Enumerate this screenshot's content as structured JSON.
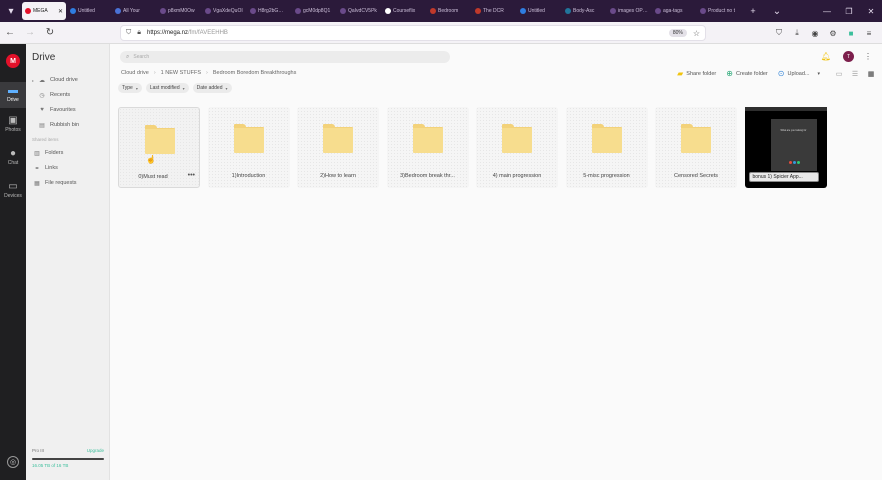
{
  "browser": {
    "tabs": [
      {
        "label": "MEGA",
        "favicon_color": "#e3112a",
        "active": true
      },
      {
        "label": "Untitled",
        "favicon_color": "#2f7de1",
        "active": false
      },
      {
        "label": "All Your",
        "favicon_color": "#4a72d6",
        "active": false
      },
      {
        "label": "p8xmM0Ow",
        "favicon_color": "#6a4a8a",
        "active": false
      },
      {
        "label": "VgaXdeQuOI",
        "favicon_color": "#6a4a8a",
        "active": false
      },
      {
        "label": "H8rg2bGW6o",
        "favicon_color": "#6a4a8a",
        "active": false
      },
      {
        "label": "gcM0dp8Q1",
        "favicon_color": "#6a4a8a",
        "active": false
      },
      {
        "label": "QaIvdCV5Pk",
        "favicon_color": "#6a4a8a",
        "active": false
      },
      {
        "label": "Courseflix",
        "favicon_color": "#ffffff",
        "active": false
      },
      {
        "label": "Bedroom",
        "favicon_color": "#c0392b",
        "active": false
      },
      {
        "label": "The DCR",
        "favicon_color": "#c0392b",
        "active": false
      },
      {
        "label": "Untitled",
        "favicon_color": "#2f7de1",
        "active": false
      },
      {
        "label": "Body-Asc",
        "favicon_color": "#21759b",
        "active": false
      },
      {
        "label": "images OPEC",
        "favicon_color": "#6a4a8a",
        "active": false
      },
      {
        "label": "aga-tags",
        "favicon_color": "#6a4a8a",
        "active": false
      },
      {
        "label": "Product no t",
        "favicon_color": "#6a4a8a",
        "active": false
      }
    ],
    "url_host": "https://mega.nz",
    "url_path": "/fm/fAVEEHHB",
    "zoom": "80%"
  },
  "rail": {
    "logo_letter": "M",
    "items": [
      {
        "label": "Drive",
        "icon": "folder-icon"
      },
      {
        "label": "Photos",
        "icon": "photo-icon"
      },
      {
        "label": "Chat",
        "icon": "chat-icon"
      },
      {
        "label": "Devices",
        "icon": "devices-icon"
      }
    ]
  },
  "sidebar": {
    "title": "Drive",
    "items": [
      {
        "label": "Cloud drive",
        "icon": "cloud-icon"
      },
      {
        "label": "Recents",
        "icon": "clock-icon"
      },
      {
        "label": "Favourites",
        "icon": "heart-icon"
      },
      {
        "label": "Rubbish bin",
        "icon": "trash-icon"
      }
    ],
    "shared_heading": "Shared items",
    "shared_items": [
      {
        "label": "Folders",
        "icon": "shared-folder-icon"
      },
      {
        "label": "Links",
        "icon": "link-icon"
      },
      {
        "label": "File requests",
        "icon": "file-request-icon"
      }
    ],
    "storage": {
      "plan": "Pro III",
      "upgrade": "Upgrade",
      "used": "16.05 TB of 16 TB",
      "fill_fraction": 1.0
    }
  },
  "header": {
    "search_placeholder": "Search",
    "avatar_initial": "T",
    "breadcrumb": [
      "Cloud drive",
      "1 NEW STUFFS",
      "Bedroom Boredom Breakthroughs"
    ],
    "actions": {
      "share": "Share folder",
      "create": "Create folder",
      "upload": "Upload..."
    }
  },
  "filters": [
    "Type",
    "Last modified",
    "Date added"
  ],
  "folders": [
    {
      "name": "0)Must read"
    },
    {
      "name": "1)Introduction"
    },
    {
      "name": "2)How to learn"
    },
    {
      "name": "3)Bedroom break thr..."
    },
    {
      "name": "4) main progression"
    },
    {
      "name": "5-misc progression"
    },
    {
      "name": "Censored Secrets"
    }
  ],
  "video": {
    "name": "bonus 1) Spicier App...",
    "frame_text": "What are you looking for"
  },
  "colors": {
    "brand": "#e3112a",
    "accent": "#3cbf9c",
    "folder": "#f7dd8e"
  }
}
